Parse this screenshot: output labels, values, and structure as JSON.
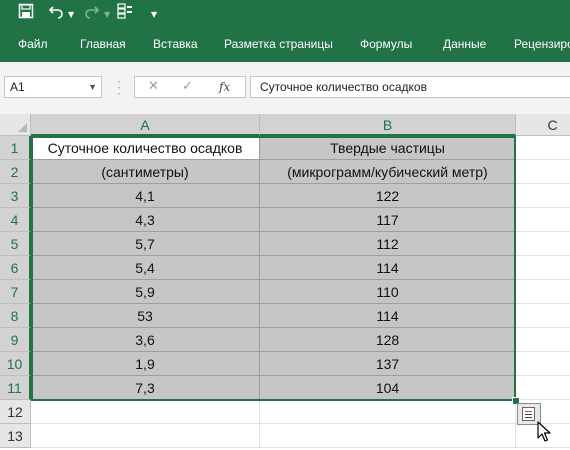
{
  "qat": {
    "save_icon": "save-icon",
    "undo_icon": "undo-icon",
    "redo_icon": "redo-icon",
    "form_icon": "form-icon",
    "customize_icon": "customize-qat-icon"
  },
  "ribbon": {
    "tabs": [
      "Файл",
      "Главная",
      "Вставка",
      "Разметка страницы",
      "Формулы",
      "Данные",
      "Рецензиро"
    ]
  },
  "formula_bar": {
    "name_box": "A1",
    "fx_label": "fx",
    "content": "Суточное количество осадков"
  },
  "sheet": {
    "columns": [
      "A",
      "B",
      "C"
    ],
    "rows": [
      "1",
      "2",
      "3",
      "4",
      "5",
      "6",
      "7",
      "8",
      "9",
      "10",
      "11",
      "12",
      "13"
    ],
    "cells": [
      [
        "Суточное количество осадков",
        "Твердые частицы"
      ],
      [
        "(сантиметры)",
        "(микрограмм/кубический метр)"
      ],
      [
        "4,1",
        "122"
      ],
      [
        "4,3",
        "117"
      ],
      [
        "5,7",
        "112"
      ],
      [
        "5,4",
        "114"
      ],
      [
        "5,9",
        "110"
      ],
      [
        "53",
        "114"
      ],
      [
        "3,6",
        "128"
      ],
      [
        "1,9",
        "137"
      ],
      [
        "7,3",
        "104"
      ]
    ]
  },
  "colors": {
    "accent": "#217346",
    "selection": "#c6c6c6"
  }
}
